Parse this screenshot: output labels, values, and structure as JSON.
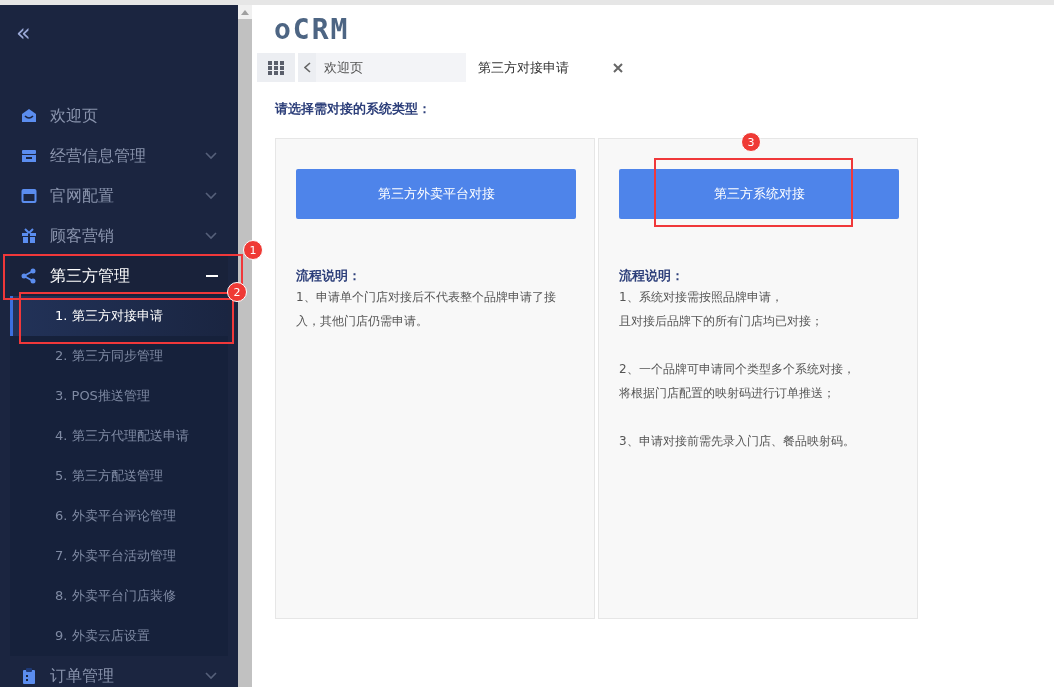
{
  "sidebar": {
    "collapse_icon": "«",
    "menu": [
      {
        "label": "欢迎页",
        "kind": "link"
      },
      {
        "label": "经营信息管理",
        "kind": "group",
        "expanded": false
      },
      {
        "label": "官网配置",
        "kind": "group",
        "expanded": false
      },
      {
        "label": "顾客营销",
        "kind": "group",
        "expanded": false
      },
      {
        "label": "第三方管理",
        "kind": "group",
        "expanded": true,
        "callout": "1",
        "children": [
          {
            "label": "1. 第三方对接申请",
            "selected": true,
            "callout": "2"
          },
          {
            "label": "2. 第三方同步管理",
            "selected": false
          },
          {
            "label": "3. POS推送管理",
            "selected": false
          },
          {
            "label": "4. 第三方代理配送申请",
            "selected": false
          },
          {
            "label": "5. 第三方配送管理",
            "selected": false
          },
          {
            "label": "6. 外卖平台评论管理",
            "selected": false
          },
          {
            "label": "7. 外卖平台活动管理",
            "selected": false
          },
          {
            "label": "8. 外卖平台门店装修",
            "selected": false
          },
          {
            "label": "9. 外卖云店设置",
            "selected": false
          }
        ]
      },
      {
        "label": "订单管理",
        "kind": "group",
        "expanded": false
      }
    ]
  },
  "header": {
    "logo": "oCRM"
  },
  "tabs": [
    {
      "label": "欢迎页",
      "selected": false
    },
    {
      "label": "第三方对接申请",
      "selected": true
    }
  ],
  "prompt": "请选择需对接的系统类型：",
  "cards": [
    {
      "button": "第三方外卖平台对接",
      "notes_title": "流程说明：",
      "paragraphs": [
        [
          "1、申请单个门店对接后不代表整个品牌申请了接入，其他门店仍需申请。"
        ]
      ]
    },
    {
      "button": "第三方系统对接",
      "callout": "3",
      "notes_title": "流程说明：",
      "paragraphs": [
        [
          "1、系统对接需按照品牌申请，",
          "且对接后品牌下的所有门店均已对接；"
        ],
        [
          "2、一个品牌可申请同个类型多个系统对接，",
          "将根据门店配置的映射码进行订单推送；"
        ],
        [
          "3、申请对接前需先录入门店、餐品映射码。"
        ]
      ]
    }
  ]
}
